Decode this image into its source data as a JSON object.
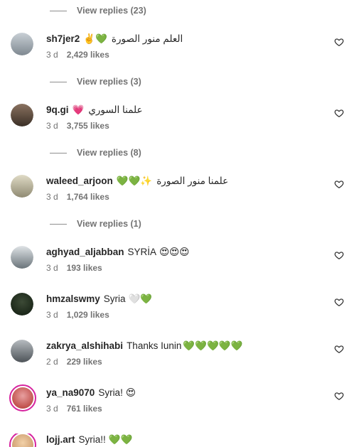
{
  "view_replies": [
    {
      "label": "View replies (23)"
    },
    {
      "label": "View replies (3)"
    },
    {
      "label": "View replies (8)"
    },
    {
      "label": "View replies (1)"
    }
  ],
  "comments": [
    {
      "username": "sh7jer2",
      "text": "العلم منور الصورة",
      "emoji": "✌️💚",
      "time": "3 d",
      "likes": "2,429 likes",
      "avatar_color": "#9aa4ad"
    },
    {
      "username": "9q.gi",
      "text": "علمنا السوري",
      "emoji": "💗",
      "time": "3 d",
      "likes": "3,755 likes",
      "avatar_color": "#5b4a3a"
    },
    {
      "username": "waleed_arjoon",
      "text": "علمنا منور الصورة",
      "emoji": "💚💚✨",
      "time": "3 d",
      "likes": "1,764 likes",
      "avatar_color": "#b8b29a"
    },
    {
      "username": "aghyad_aljabban",
      "text": "SYRİA",
      "emoji": "😍😍😍",
      "time": "3 d",
      "likes": "193 likes",
      "avatar_color": "#7f8a8f"
    },
    {
      "username": "hmzalswmy",
      "text": "Syria",
      "emoji": "🤍💚",
      "time": "3 d",
      "likes": "1,029 likes",
      "avatar_color": "#2b3a2a"
    },
    {
      "username": "zakrya_alshihabi",
      "text": "Thanks Iunin",
      "emoji": "💚💚💚💚💚",
      "time": "2 d",
      "likes": "229 likes",
      "avatar_color": "#8a9096"
    },
    {
      "username": "ya_na9070",
      "text": "Syria!",
      "emoji": "😍",
      "time": "3 d",
      "likes": "761 likes",
      "avatar_color": "#c0392b"
    },
    {
      "username": "lojj.art",
      "text": "Syria!!",
      "emoji": "💚💚",
      "time": "",
      "likes": "",
      "avatar_color": "#d9a679"
    }
  ],
  "colors": {
    "story_ring": "#d6249f",
    "muted": "#737373",
    "text": "#262626"
  }
}
